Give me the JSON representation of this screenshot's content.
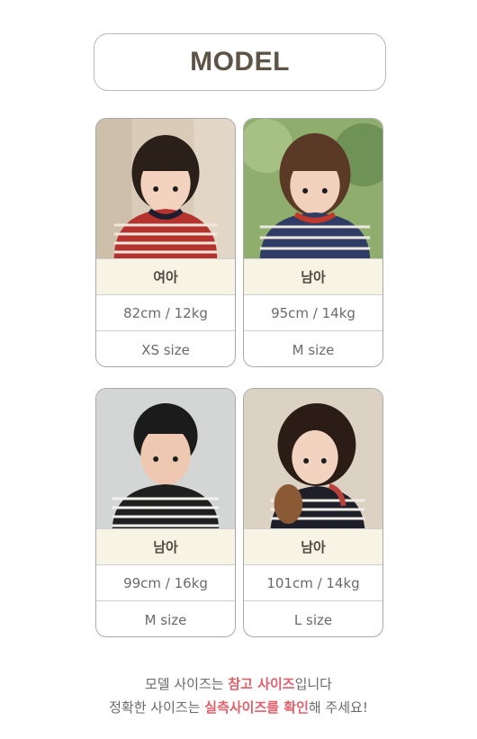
{
  "header": {
    "title": "MODEL"
  },
  "models": [
    {
      "gender": "여아",
      "measure": "82cm / 12kg",
      "size": "XS size",
      "photo_icon": "girl-photo"
    },
    {
      "gender": "남아",
      "measure": "95cm / 14kg",
      "size": "M size",
      "photo_icon": "boy-photo"
    },
    {
      "gender": "남아",
      "measure": "99cm / 16kg",
      "size": "M size",
      "photo_icon": "boy-photo"
    },
    {
      "gender": "남아",
      "measure": "101cm / 14kg",
      "size": "L size",
      "photo_icon": "child-photo"
    }
  ],
  "notes": {
    "line1_a": "모델 사이즈는 ",
    "line1_b": "참고 사이즈",
    "line1_c": "입니다",
    "line2_a": "정확한 사이즈는 ",
    "line2_b": "실측사이즈를 확인",
    "line2_c": "해 주세요!"
  },
  "colors": {
    "accent": "#e0606a",
    "label_bg": "#f7f4e6",
    "title": "#5d5446"
  }
}
